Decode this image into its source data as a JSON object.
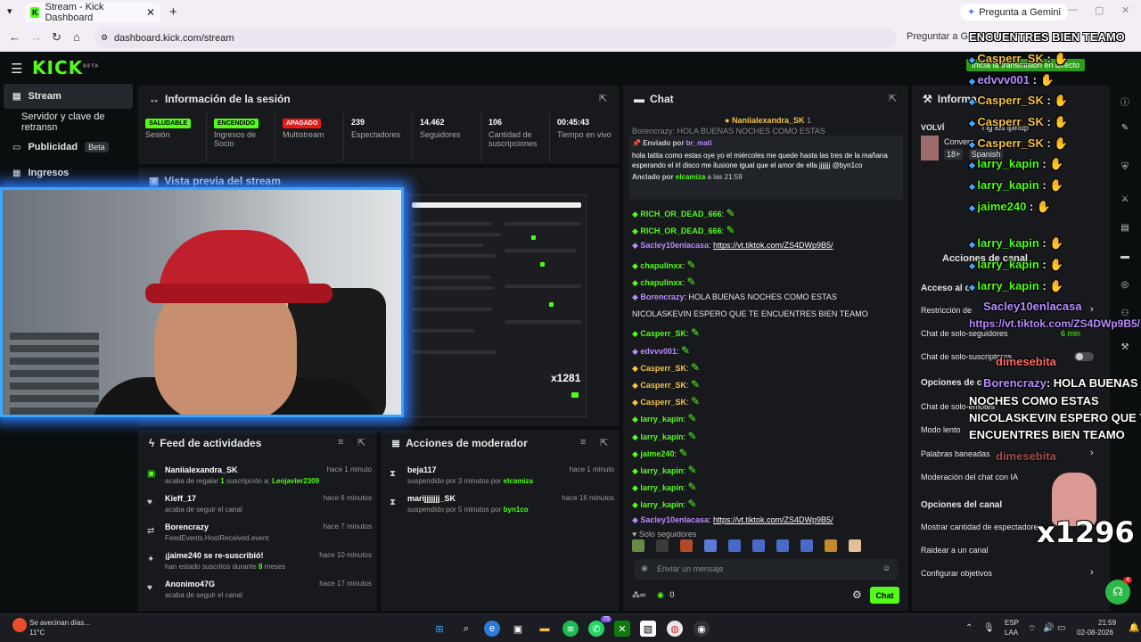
{
  "browser": {
    "tab_title": "Stream - Kick Dashboard",
    "tab_close": "✕",
    "new_tab": "+",
    "gemini_button": "Pregunta a Gemini",
    "url": "dashboard.kick.com/stream",
    "ask_button": "Preguntar a G"
  },
  "app": {
    "logo": "KICK",
    "logo_sup": "BETA"
  },
  "sidebar": {
    "items": [
      {
        "label": "Stream"
      },
      {
        "label": "Servidor y clave de retransn"
      },
      {
        "label": "Publicidad",
        "badge": "Beta"
      },
      {
        "label": "Ingresos"
      }
    ]
  },
  "session": {
    "title": "Información de la sesión",
    "stats": [
      {
        "value": "SALUDABLE",
        "label": "Sesión",
        "kind": "pill-green"
      },
      {
        "value": "ENCENDIDO",
        "label": "Ingresos de Socio",
        "kind": "pill-green"
      },
      {
        "value": "APAGADO",
        "label": "Multistream",
        "kind": "pill-red"
      },
      {
        "value": "239",
        "label": "Espectadores"
      },
      {
        "value": "14.462",
        "label": "Seguidores"
      },
      {
        "value": "106",
        "label": "Cantidad de suscripciones"
      },
      {
        "value": "00:45:43",
        "label": "Tiempo en vivo"
      }
    ]
  },
  "preview": {
    "title": "Vista previa del stream",
    "mini_counter": "x1281"
  },
  "feed": {
    "title": "Feed de actividades",
    "items": [
      {
        "name": "Naniialexandra_SK",
        "desc_pre": "acaba de regalar",
        "desc_num": "1",
        "desc_mid": "suscripción a:",
        "desc_hl": "Leojavier2309",
        "time": "hace 1 minuto",
        "icon": "gift-icon"
      },
      {
        "name": "Kieff_17",
        "desc": "acaba de seguir el canal",
        "time": "hace 6 minutos",
        "icon": "heart-icon"
      },
      {
        "name": "Borencrazy",
        "desc": "FeedEvents.HostReceived.event",
        "time": "hace 7 minutos",
        "icon": "host-icon"
      },
      {
        "name": "¡jaime240 se re-suscribió!",
        "desc_pre": "han estado suscritos durante",
        "desc_num": "8",
        "desc_mid": "meses",
        "time": "hace 10 minutos",
        "icon": "star-icon"
      },
      {
        "name": "Anonimo47G",
        "desc": "acaba de seguir el canal",
        "time": "hace 17 minutos",
        "icon": "heart-icon"
      }
    ]
  },
  "moderator": {
    "title": "Acciones de moderador",
    "items": [
      {
        "name": "beja117",
        "desc": "suspendido por 3 minutos por",
        "by": "elcamiza",
        "time": "hace 1 minuto"
      },
      {
        "name": "marijjjjjjj_SK",
        "desc": "suspendido por 5 minutos por",
        "by": "byn1co",
        "time": "hace 16 minutos"
      }
    ]
  },
  "chat": {
    "title": "Chat",
    "top_gift": "Naniialexandra_SK",
    "top_gift_count": "1",
    "top_cutoff": "Borencrazy: HOLA BUENAS NOCHES COMO ESTAS",
    "pinned": {
      "sent_by_label": "Enviado por",
      "sent_by": "br_mati",
      "text": "hola tatita como estas oye yo el miércoles me quede hasta las tres de la mañana esperando el irl disco me ilusione igual que el amor de ella jjjjjjj @byn1co",
      "pinned_by_label": "Anclado por",
      "pinned_by": "elcamiza",
      "pinned_time": "a las 21:59"
    },
    "messages": [
      {
        "user": "RICH_OR_DEAD_666",
        "color": "#53fc18",
        "text": ""
      },
      {
        "user": "RICH_OR_DEAD_666",
        "color": "#53fc18",
        "text": ""
      },
      {
        "user": "Sacley10enlacasa",
        "color": "#b98bff",
        "text": "https://vt.tiktok.com/ZS4DWp9B5/"
      },
      {
        "user": "chapulinxx",
        "color": "#53fc18",
        "text": ""
      },
      {
        "user": "chapulinxx",
        "color": "#53fc18",
        "text": ""
      },
      {
        "user": "Borencrazy",
        "color": "#b98bff",
        "text": "HOLA BUENAS NOCHES COMO ESTAS"
      },
      {
        "user": "",
        "color": "#e6e6e6",
        "text": "NICOLASKEVIN ESPERO QUE TE ENCUENTRES BIEN TEAMO"
      },
      {
        "user": "Casperr_SK",
        "color": "#53fc18",
        "text": ""
      },
      {
        "user": "edvvv001",
        "color": "#b98bff",
        "text": ""
      },
      {
        "user": "Casperr_SK",
        "color": "#f4c247",
        "text": ""
      },
      {
        "user": "Casperr_SK",
        "color": "#f4c247",
        "text": ""
      },
      {
        "user": "Casperr_SK",
        "color": "#f4c247",
        "text": ""
      },
      {
        "user": "larry_kapin",
        "color": "#53fc18",
        "text": ""
      },
      {
        "user": "larry_kapin",
        "color": "#53fc18",
        "text": ""
      },
      {
        "user": "jaime240",
        "color": "#53fc18",
        "text": ""
      },
      {
        "user": "larry_kapin",
        "color": "#53fc18",
        "text": ""
      },
      {
        "user": "larry_kapin",
        "color": "#53fc18",
        "text": ""
      },
      {
        "user": "larry_kapin",
        "color": "#53fc18",
        "text": ""
      },
      {
        "user": "Sacley10enlacasa",
        "color": "#b98bff",
        "text": "https://vt.tiktok.com/ZS4DWp9B5/"
      }
    ],
    "followers_only": "Solo seguidores",
    "input_placeholder": "Enviar un mensaje",
    "points": "0",
    "send_label": "Chat"
  },
  "right_panel": {
    "info_title": "Informa",
    "info_category_top": "VOLVÍ",
    "info_category_cutoff": "l ig ids ipinup",
    "info_sub": "Convers",
    "info_tag_age": "18+",
    "info_tag_lang": "Spanish",
    "actions_title": "Acciones de canal",
    "access_title": "Acceso al c",
    "access_items": [
      {
        "label": "Restricción de",
        "kind": "chevron"
      },
      {
        "label": "Chat de solo-seguidores",
        "value": "6 min"
      },
      {
        "label": "Chat de solo-suscriptores",
        "kind": "toggle"
      }
    ],
    "chat_options_title": "Opciones de c",
    "chat_option_items": [
      {
        "label": "Chat de solo-emotes"
      },
      {
        "label": "Modo lento"
      },
      {
        "label": "Palabras baneadas",
        "kind": "chevron"
      },
      {
        "label": "Moderación del chat con IA"
      }
    ],
    "channel_options_title": "Opciones del canal",
    "channel_option_items": [
      {
        "label": "Mostrar cantidad de espectadores"
      },
      {
        "label": "Raidear a un canal"
      },
      {
        "label": "Configurar objetivos",
        "kind": "chevron"
      }
    ]
  },
  "overlay": {
    "banner": "Inicia la transmisión en directo",
    "top_text": "ENCUENTRES BIEN TEAMO",
    "lines": [
      {
        "user": "Casperr_SK",
        "color": "#f4c247"
      },
      {
        "user": "edvvv001",
        "color": "#b98bff"
      },
      {
        "user": "Casperr_SK",
        "color": "#f4c247"
      },
      {
        "user": "Casperr_SK",
        "color": "#f4c247"
      },
      {
        "user": "Casperr_SK",
        "color": "#f4c247"
      },
      {
        "user": "larry_kapin",
        "color": "#53fc18"
      },
      {
        "user": "larry_kapin",
        "color": "#53fc18"
      },
      {
        "user": "jaime240",
        "color": "#53fc18"
      },
      {
        "user": "larry_kapin",
        "color": "#53fc18"
      },
      {
        "user": "larry_kapin",
        "color": "#53fc18"
      },
      {
        "user": "larry_kapin",
        "color": "#53fc18"
      }
    ],
    "sacley_user": "Sacley10enlacasa",
    "sacley_link": "https://vt.tiktok.com/ZS4DWp9B5/",
    "dimesebita": "dimesebita",
    "boren_user": "Borencrazy",
    "boren_text_1": ": HOLA BUENAS",
    "boren_text_2": "NOCHES COMO ESTAS",
    "boren_text_3": "NICOLASKEVIN ESPERO QUE TE",
    "boren_text_4": "ENCUENTRES BIEN TEAMO",
    "counter": "x1296"
  },
  "taskbar": {
    "weather_title": "Se avecinan días...",
    "weather_temp": "11°C",
    "lang": "ESP",
    "lang2": "LAA",
    "time": "21:59",
    "date": "02-08-2026",
    "whatsapp_badge": "75",
    "support_badge": "4"
  }
}
